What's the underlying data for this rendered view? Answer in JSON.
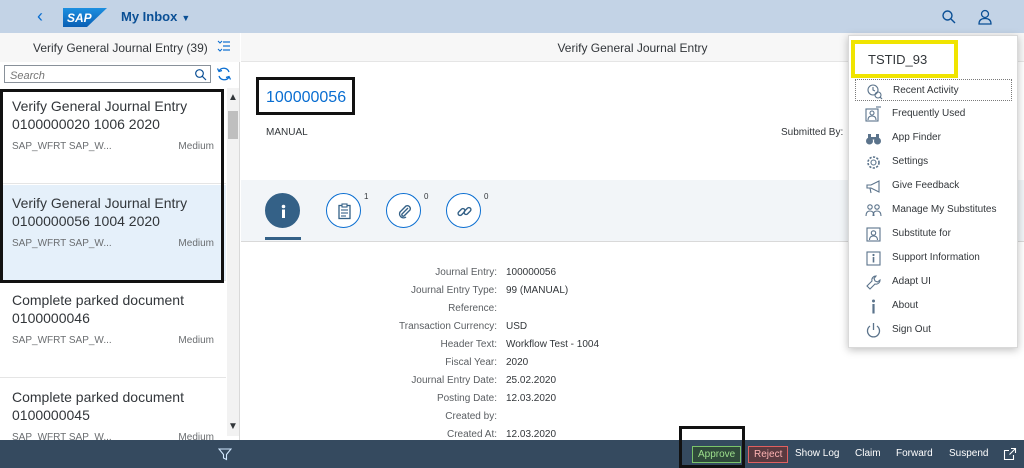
{
  "shell": {
    "logo_text": "SAP",
    "app_title": "My Inbox",
    "brand_color": "#0a6ed1"
  },
  "master": {
    "title": "Verify General Journal Entry (39)",
    "search_placeholder": "Search",
    "items": [
      {
        "title": "Verify General Journal Entry 0100000020 1006 2020",
        "subtitle": "SAP_WFRT SAP_W...",
        "priority": "Medium",
        "selected": false
      },
      {
        "title": "Verify General Journal Entry 0100000056 1004 2020",
        "subtitle": "SAP_WFRT SAP_W...",
        "priority": "Medium",
        "selected": true
      },
      {
        "title": "Complete parked document 0100000046",
        "subtitle": "SAP_WFRT SAP_W...",
        "priority": "Medium",
        "selected": false
      },
      {
        "title": "Complete parked document 0100000045",
        "subtitle": "SAP_WFRT SAP_W...",
        "priority": "Medium",
        "selected": false
      }
    ]
  },
  "detail": {
    "header_title": "Verify General Journal Entry",
    "object_number": "100000056",
    "object_type": "MANUAL",
    "submitted_by_label": "Submitted By:",
    "tabs": [
      {
        "icon": "info-icon",
        "count": ""
      },
      {
        "icon": "notes-icon",
        "count": "1"
      },
      {
        "icon": "attachment-icon",
        "count": "0"
      },
      {
        "icon": "link-icon",
        "count": "0"
      }
    ],
    "fields": [
      {
        "label": "Journal Entry:",
        "value": "100000056"
      },
      {
        "label": "Journal Entry Type:",
        "value": "99 (MANUAL)"
      },
      {
        "label": "Reference:",
        "value": ""
      },
      {
        "label": "Transaction Currency:",
        "value": "USD"
      },
      {
        "label": "Header Text:",
        "value": "Workflow Test - 1004"
      },
      {
        "label": "Fiscal Year:",
        "value": "2020"
      },
      {
        "label": "Journal Entry Date:",
        "value": "25.02.2020"
      },
      {
        "label": "Posting Date:",
        "value": "12.03.2020"
      },
      {
        "label": "Created by:",
        "value": ""
      },
      {
        "label": "Created At:",
        "value": "12.03.2020"
      }
    ]
  },
  "footer": {
    "approve": "Approve",
    "reject": "Reject",
    "show_log": "Show Log",
    "claim": "Claim",
    "forward": "Forward",
    "suspend": "Suspend"
  },
  "user_menu": {
    "user_id": "TSTID_93",
    "items": [
      {
        "label": "Recent Activity",
        "icon": "recent-activity-icon"
      },
      {
        "label": "Frequently Used",
        "icon": "frequently-used-icon"
      },
      {
        "label": "App Finder",
        "icon": "binoculars-icon"
      },
      {
        "label": "Settings",
        "icon": "settings-icon"
      },
      {
        "label": "Give Feedback",
        "icon": "megaphone-icon"
      },
      {
        "label": "Manage My Substitutes",
        "icon": "substitutes-icon"
      },
      {
        "label": "Substitute for",
        "icon": "substitute-for-icon"
      },
      {
        "label": "Support Information",
        "icon": "support-info-icon"
      },
      {
        "label": "Adapt UI",
        "icon": "wrench-icon"
      },
      {
        "label": "About",
        "icon": "about-icon"
      },
      {
        "label": "Sign Out",
        "icon": "sign-out-icon"
      }
    ]
  }
}
